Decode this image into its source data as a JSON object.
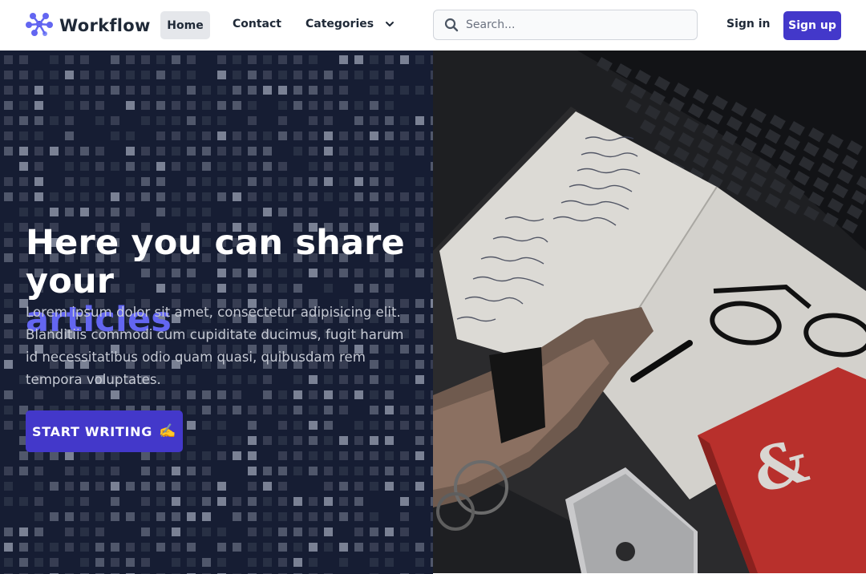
{
  "header": {
    "brand": "Workflow",
    "nav": {
      "home": "Home",
      "contact": "Contact",
      "categories": "Categories"
    },
    "search": {
      "placeholder": "Search..."
    },
    "sign_in": "Sign in",
    "sign_up": "Sign up"
  },
  "hero": {
    "title_line1": "Here you can share",
    "title_line2": "your",
    "title_accent": "articles",
    "body": "Lorem ipsum dolor sit amet, consectetur adipisicing elit. Blanditiis commodi cum cupiditate ducimus, fugit harum id necessitatibus odio quam quasi, quibusdam rem tempora voluptates.",
    "cta_label": "START WRITING",
    "cta_emoji": "✍️"
  },
  "icons": {
    "logo": "workflow-logo-icon",
    "search": "search-icon",
    "chevron": "chevron-down-icon"
  },
  "colors": {
    "accent": "#4338ca",
    "accent_text": "#6366f1",
    "hero_bg": "#161d33"
  }
}
